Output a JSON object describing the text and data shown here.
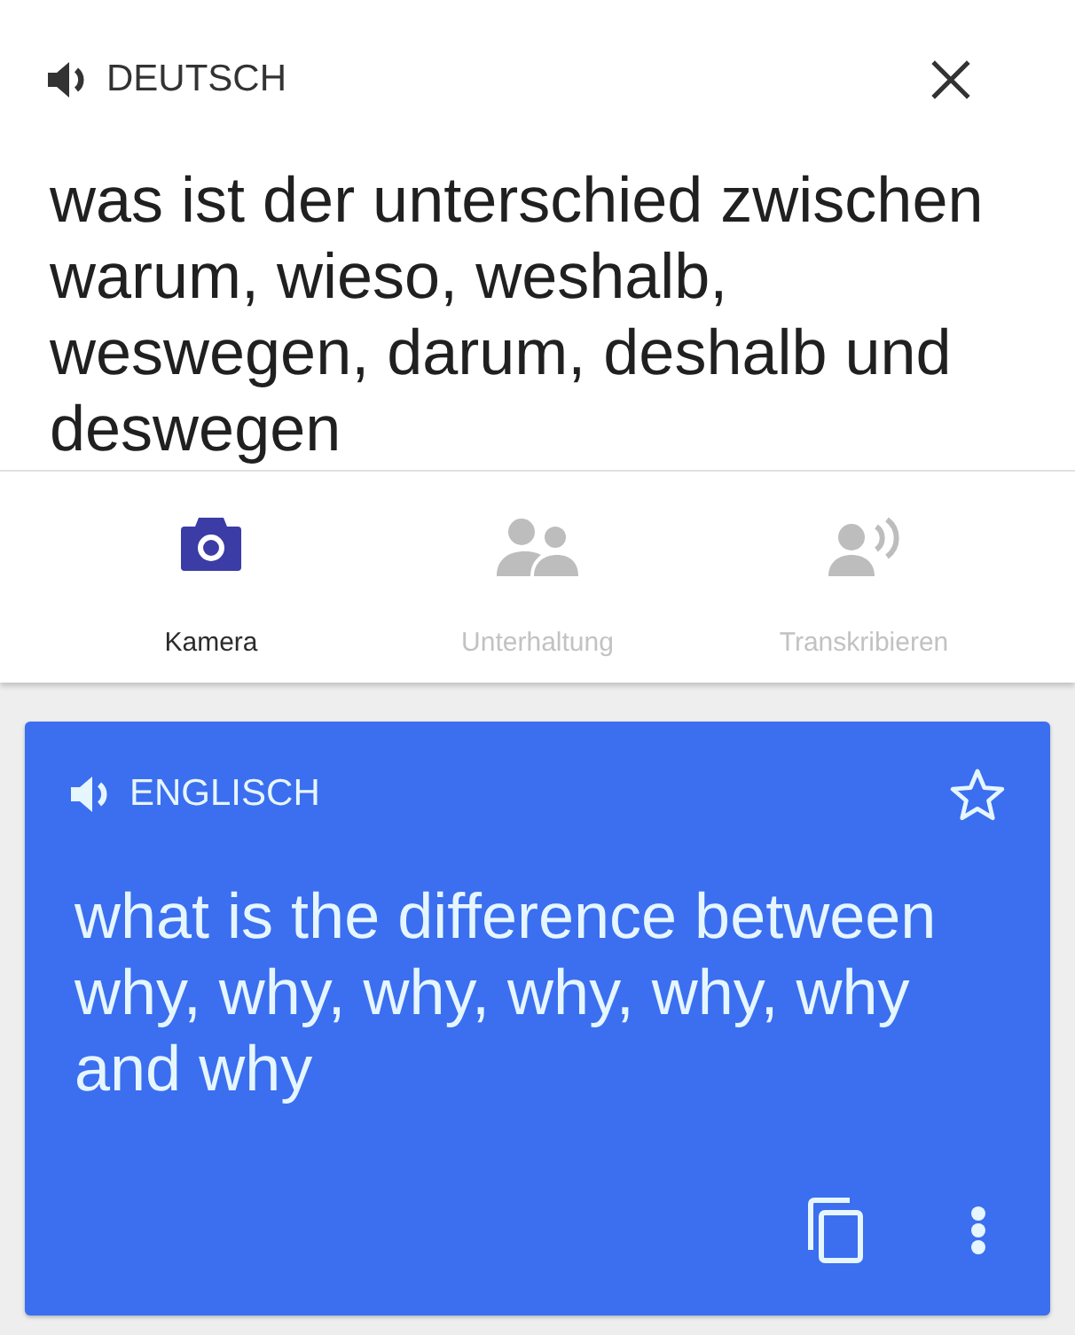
{
  "source": {
    "language": "DEUTSCH",
    "text": "was ist der unterschied zwischen warum, wieso, weshalb, weswegen, darum, deshalb und deswegen"
  },
  "modes": [
    {
      "kind": "camera",
      "label": "Kamera",
      "selected": true
    },
    {
      "kind": "conversation",
      "label": "Unterhaltung",
      "selected": false
    },
    {
      "kind": "transcribe",
      "label": "Transkribieren",
      "selected": false
    }
  ],
  "translation": {
    "language": "ENGLISCH",
    "text": "what is the difference between why, why, why, why, why, why and why"
  }
}
